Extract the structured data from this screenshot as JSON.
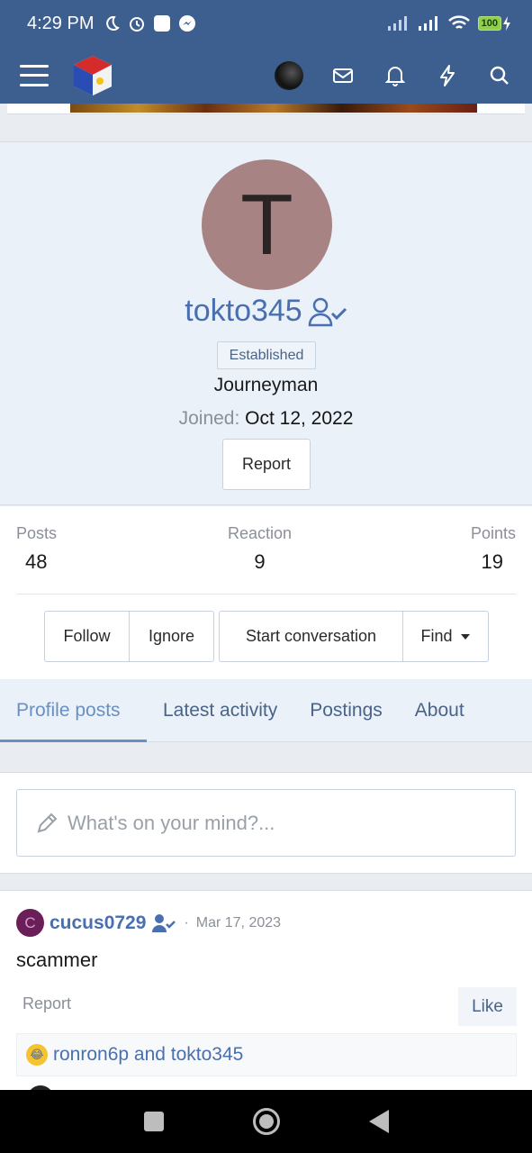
{
  "status_bar": {
    "time": "4:29 PM",
    "battery": "100"
  },
  "header": {
    "menu_icon": "hamburger-icon",
    "logo": "site-logo"
  },
  "profile": {
    "avatar_letter": "T",
    "username": "tokto345",
    "badge": "Established",
    "rank": "Journeyman",
    "joined_label": "Joined:",
    "joined_date": "Oct 12, 2022",
    "report_label": "Report"
  },
  "stats": [
    {
      "label": "Posts",
      "value": "48"
    },
    {
      "label": "Reaction",
      "value": "9"
    },
    {
      "label": "Points",
      "value": "19"
    }
  ],
  "actions": {
    "follow": "Follow",
    "ignore": "Ignore",
    "start_conversation": "Start conversation",
    "find": "Find"
  },
  "tabs": [
    {
      "label": "Profile posts",
      "active": true
    },
    {
      "label": "Latest activity",
      "active": false
    },
    {
      "label": "Postings",
      "active": false
    },
    {
      "label": "About",
      "active": false
    }
  ],
  "composer": {
    "placeholder": "What's on your mind?..."
  },
  "post": {
    "avatar_letter": "C",
    "author": "cucus0729",
    "separator": "·",
    "date": "Mar 17, 2023",
    "body": "scammer",
    "report_label": "Report",
    "like_label": "Like",
    "reactions_text": "ronron6p and tokto345"
  },
  "colors": {
    "brand": "#3d5f90",
    "link": "#4a6fb0",
    "avatar_bg": "#a88383"
  }
}
